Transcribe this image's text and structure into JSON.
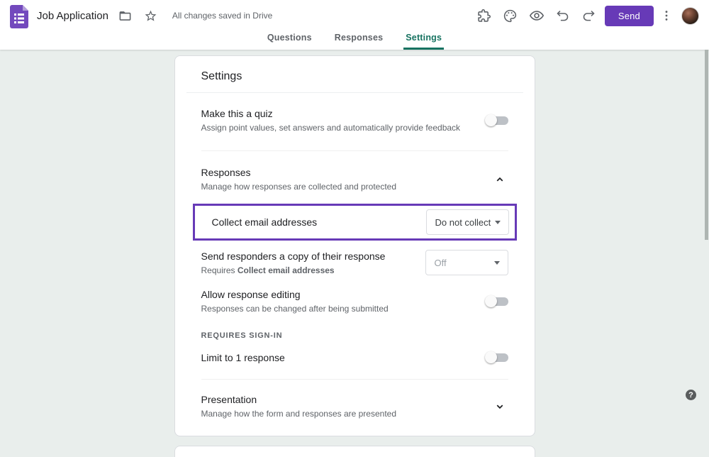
{
  "header": {
    "title": "Job Application",
    "save_status": "All changes saved in Drive",
    "send_label": "Send"
  },
  "tabs": {
    "items": [
      {
        "label": "Questions",
        "active": false
      },
      {
        "label": "Responses",
        "active": false
      },
      {
        "label": "Settings",
        "active": true
      }
    ]
  },
  "settings": {
    "heading": "Settings",
    "quiz": {
      "title": "Make this a quiz",
      "description": "Assign point values, set answers and automatically provide feedback",
      "toggle_state": "off"
    },
    "responses_section": {
      "title": "Responses",
      "description": "Manage how responses are collected and protected",
      "expanded": true
    },
    "collect_email": {
      "label": "Collect email addresses",
      "selected_value": "Do not collect",
      "highlighted": true
    },
    "send_copy": {
      "label": "Send responders a copy of their response",
      "requires_prefix": "Requires ",
      "requires_bold": "Collect email addresses",
      "selected_value": "Off",
      "disabled": true
    },
    "response_editing": {
      "title": "Allow response editing",
      "description": "Responses can be changed after being submitted",
      "toggle_state": "off"
    },
    "sign_in_header": "REQUIRES SIGN-IN",
    "limit_response": {
      "title": "Limit to 1 response",
      "toggle_state": "off"
    },
    "presentation_section": {
      "title": "Presentation",
      "description": "Manage how the form and responses are presented",
      "expanded": false
    }
  },
  "footer": {
    "help_glyph": "?"
  },
  "colors": {
    "accent_purple": "#673ab7",
    "tab_active_teal": "#177361",
    "icon_gray": "#5f6368",
    "background": "#e9eeec"
  }
}
